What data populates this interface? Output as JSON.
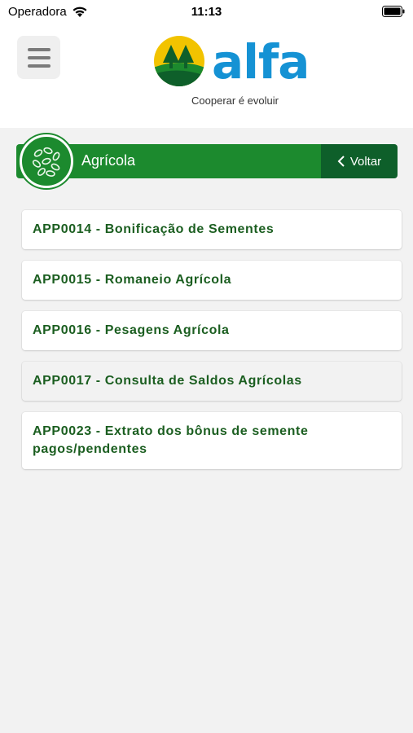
{
  "status_bar": {
    "carrier": "Operadora",
    "time": "11:13"
  },
  "header": {
    "logo_text": "alfa",
    "tagline": "Cooperar é evoluir",
    "brand_colors": {
      "blue": "#1592d4",
      "green": "#1c8a2e",
      "yellow": "#f2c300"
    }
  },
  "section": {
    "title": "Agrícola",
    "icon": "seeds-icon",
    "back_label": "Voltar",
    "colors": {
      "bar": "#1c8a2e",
      "back": "#0e5f2a"
    }
  },
  "apps": [
    {
      "label": "APP0014 - Bonificação de Sementes"
    },
    {
      "label": "APP0015 - Romaneio Agrícola"
    },
    {
      "label": "APP0016 - Pesagens Agrícola"
    },
    {
      "label": "APP0017 - Consulta de Saldos Agrícolas"
    },
    {
      "label": "APP0023 - Extrato dos bônus de semente pagos/pendentes"
    }
  ]
}
